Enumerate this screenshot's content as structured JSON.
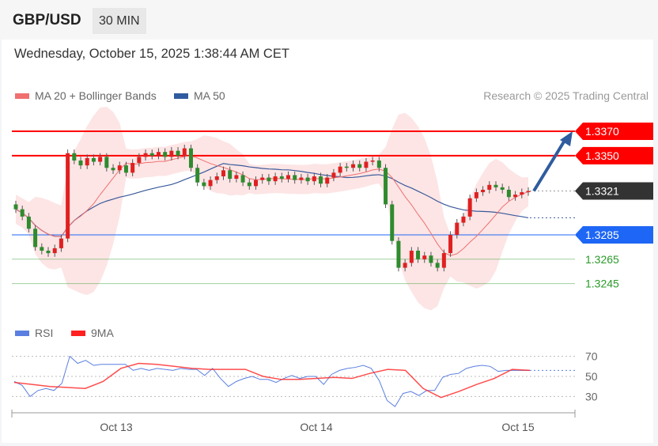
{
  "header": {
    "symbol": "GBP/USD",
    "timeframe": "30 MIN"
  },
  "timestamp": "Wednesday, October 15, 2025 1:38:44 AM CET",
  "legend": {
    "ma20": "MA 20 + Bollinger Bands",
    "ma50": "MA 50",
    "copyright": "Research © 2025 Trading Central",
    "rsi": "RSI",
    "rsi_ma": "9MA"
  },
  "colors": {
    "up": "#e02020",
    "down": "#2e8b2e",
    "ma20": "#f07070",
    "ma50": "#3a5a9a",
    "band": "#fde0e0",
    "resistance": "#ff0000",
    "pivot": "#1e66f5",
    "support": "#2a9a2a",
    "last": "#333333",
    "rsi": "#5a7fe0",
    "rsi_ma": "#ff2020"
  },
  "chart_data": [
    {
      "type": "candlestick",
      "title": "GBP/USD 30 MIN",
      "ylim": [
        1.3225,
        1.3385
      ],
      "x_labels": [
        "Oct 13",
        "Oct 14",
        "Oct 15"
      ],
      "closes": [
        1.3306,
        1.33,
        1.329,
        1.3275,
        1.3272,
        1.327,
        1.3274,
        1.3282,
        1.3352,
        1.3346,
        1.3342,
        1.3348,
        1.3345,
        1.3349,
        1.334,
        1.3338,
        1.3342,
        1.3336,
        1.3344,
        1.3349,
        1.3352,
        1.335,
        1.3353,
        1.3349,
        1.3354,
        1.335,
        1.3356,
        1.334,
        1.3328,
        1.3325,
        1.333,
        1.3333,
        1.3338,
        1.3331,
        1.3334,
        1.3328,
        1.3325,
        1.333,
        1.3332,
        1.3329,
        1.3333,
        1.3331,
        1.3334,
        1.333,
        1.3332,
        1.3329,
        1.3333,
        1.3327,
        1.3332,
        1.3336,
        1.3341,
        1.334,
        1.3343,
        1.334,
        1.3345,
        1.3346,
        1.334,
        1.331,
        1.328,
        1.3258,
        1.3262,
        1.3272,
        1.3265,
        1.3268,
        1.3262,
        1.3258,
        1.327,
        1.3285,
        1.3295,
        1.33,
        1.3315,
        1.332,
        1.3322,
        1.3326,
        1.3324,
        1.3322,
        1.3316,
        1.3318,
        1.332,
        1.3321
      ],
      "levels": [
        {
          "label": "1.3370",
          "value": 1.337,
          "kind": "resistance"
        },
        {
          "label": "1.3350",
          "value": 1.335,
          "kind": "resistance"
        },
        {
          "label": "1.3321",
          "value": 1.3321,
          "kind": "last"
        },
        {
          "label": "1.3285",
          "value": 1.3285,
          "kind": "pivot"
        },
        {
          "label": "1.3265",
          "value": 1.3265,
          "kind": "support"
        },
        {
          "label": "1.3245",
          "value": 1.3245,
          "kind": "support"
        }
      ],
      "arrow": {
        "from": 1.3321,
        "to": 1.337,
        "direction": "up"
      }
    },
    {
      "type": "line",
      "title": "RSI",
      "ylim": [
        15,
        80
      ],
      "y_ticks": [
        "70",
        "50",
        "30"
      ],
      "rsi": [
        45,
        41,
        30,
        36,
        38,
        36,
        43,
        70,
        63,
        66,
        61,
        62,
        62,
        62,
        62,
        56,
        58,
        56,
        58,
        57,
        56,
        58,
        57,
        57,
        51,
        58,
        48,
        40,
        45,
        48,
        50,
        47,
        47,
        44,
        48,
        51,
        48,
        50,
        50,
        42,
        52,
        56,
        58,
        59,
        61,
        58,
        46,
        26,
        20,
        33,
        35,
        31,
        36,
        36,
        49,
        52,
        53,
        58,
        60,
        61,
        60,
        55,
        56,
        56,
        56,
        56
      ],
      "rsi_ma": [
        44,
        42,
        40,
        39,
        38,
        45,
        58,
        63,
        62,
        60,
        58,
        57,
        57,
        57,
        50,
        47,
        47,
        48,
        49,
        48,
        53,
        57,
        56,
        38,
        29,
        35,
        42,
        48,
        57,
        56
      ]
    }
  ]
}
